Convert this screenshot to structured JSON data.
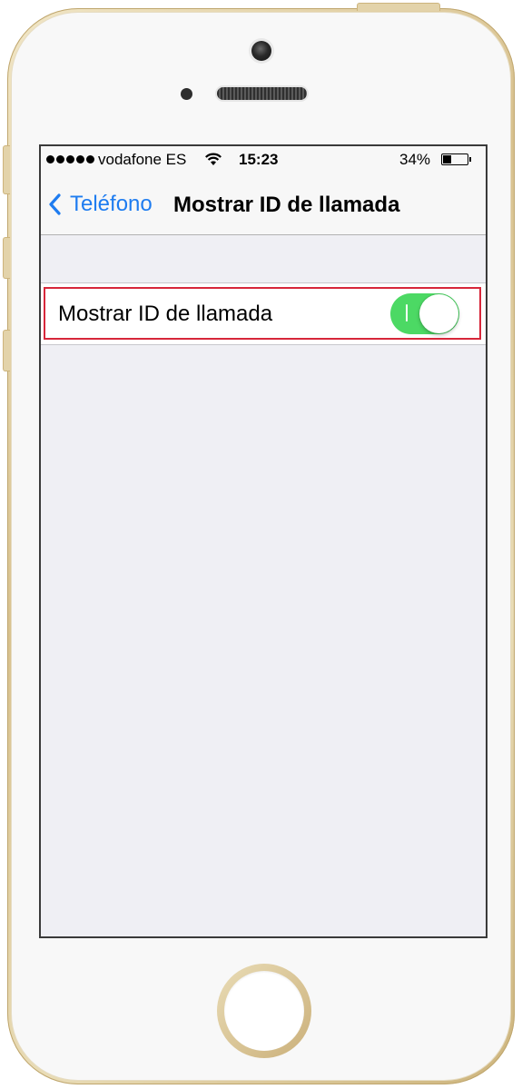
{
  "statusbar": {
    "carrier": "vodafone ES",
    "time": "15:23",
    "battery_percent": "34%",
    "battery_level": 0.34,
    "signal_bars": 5
  },
  "navbar": {
    "back_label": "Teléfono",
    "title": "Mostrar ID de llamada"
  },
  "settings": {
    "show_caller_id": {
      "label": "Mostrar ID de llamada",
      "enabled": true
    }
  },
  "colors": {
    "accent": "#1e7cf0",
    "toggle_on": "#4cd964",
    "highlight": "#d7273a"
  }
}
